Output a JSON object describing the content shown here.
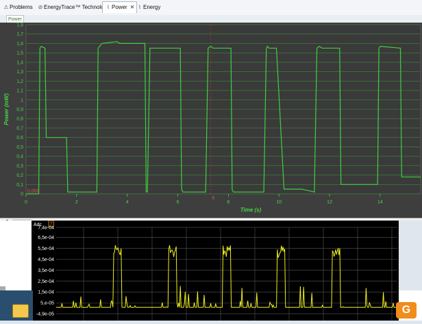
{
  "tabs": [
    {
      "label": "Problems",
      "icon": "problems-icon",
      "active": false
    },
    {
      "label": "EnergyTrace™ Technology",
      "icon": "energytrace-icon",
      "active": false
    },
    {
      "label": "Power",
      "icon": "chart-icon",
      "active": true
    },
    {
      "label": "Energy",
      "icon": "chart-icon",
      "active": false
    }
  ],
  "power_view": {
    "tab_label": "Power",
    "marker_label": "0,000",
    "marker_label_mid": "6"
  },
  "adc_view": {
    "badge": "7"
  },
  "taskbar": {
    "app_letter": "G"
  },
  "chart_data": [
    {
      "type": "line",
      "ylabel": "Power (mW)",
      "xlabel": "Time (s)",
      "ylim": [
        0,
        1.8
      ],
      "xlim": [
        0,
        15.6
      ],
      "yticks": [
        "0",
        "0,1",
        "0,2",
        "0,3",
        "0,4",
        "0,5",
        "0,6",
        "0,7",
        "0,8",
        "0,9",
        "1",
        "1,1",
        "1,2",
        "1,3",
        "1,4",
        "1,5",
        "1,6",
        "1,7",
        "1,8"
      ],
      "xticks": [
        "0",
        "2",
        "4",
        "6",
        "8",
        "10",
        "12",
        "14"
      ],
      "xtick_values": [
        0,
        2,
        4,
        6,
        8,
        10,
        12,
        14
      ],
      "grid": true,
      "color": "#40d040",
      "series": [
        {
          "x": [
            0,
            0.5,
            0.55,
            0.6,
            0.75,
            0.8,
            1.0,
            1.0,
            1.6,
            1.65,
            2.7,
            2.8,
            2.85,
            3.0,
            3.6,
            3.7,
            3.8,
            4.7,
            4.75,
            4.8,
            4.9,
            5.1,
            6.1,
            6.15,
            6.2,
            6.3,
            6.5,
            7.0,
            7.1,
            7.2,
            7.3,
            7.4,
            7.6,
            8.1,
            8.15,
            8.2,
            8.3,
            8.4,
            8.6,
            9.4,
            9.5,
            9.55,
            9.6,
            9.7,
            9.9,
            10.2,
            10.25,
            10.3,
            10.9,
            11.4,
            11.5,
            11.6,
            11.7,
            11.8,
            12.4,
            12.45,
            12.5,
            13.8,
            13.9,
            13.95,
            14.0,
            14.8,
            14.85,
            14.9,
            15.6
          ],
          "y": [
            0,
            0,
            1.55,
            1.57,
            1.55,
            0.6,
            0.6,
            0.6,
            0.6,
            0.02,
            0.02,
            0.02,
            1.55,
            1.6,
            1.62,
            1.6,
            1.6,
            1.6,
            0.02,
            0.02,
            1.55,
            1.55,
            1.55,
            0.05,
            0.02,
            0.02,
            0.02,
            0.02,
            0.02,
            1.55,
            1.57,
            1.55,
            1.55,
            1.55,
            0.04,
            0.02,
            0.02,
            0.02,
            0.02,
            0.02,
            1.55,
            1.57,
            1.55,
            1.55,
            1.55,
            0.05,
            0.05,
            0.05,
            0.05,
            0.02,
            1.55,
            1.57,
            1.55,
            1.55,
            1.55,
            0.1,
            0.1,
            0.1,
            0.1,
            1.55,
            1.57,
            1.55,
            0.18,
            0.18,
            0.18
          ]
        }
      ]
    },
    {
      "type": "line",
      "ylabel": "Adc",
      "yticks": [
        "-4,9e-05",
        "5,e-05",
        "1,5e-04",
        "2,5e-04",
        "3,5e-04",
        "4,5e-04",
        "5,5e-04",
        "6,5e-04",
        "7,4e-04"
      ],
      "ytick_values": [
        -4.9e-05,
        5e-05,
        0.00015,
        0.00025,
        0.00035,
        0.00045,
        0.00055,
        0.00065,
        0.00074
      ],
      "ylim": [
        -4.9e-05,
        0.00074
      ],
      "grid": true,
      "color": "#f0f020",
      "background": "#000000",
      "bursts": [
        0.18,
        0.34,
        0.5,
        0.66,
        0.82
      ],
      "burst_peak": 0.00058,
      "baseline": 1e-05
    }
  ]
}
